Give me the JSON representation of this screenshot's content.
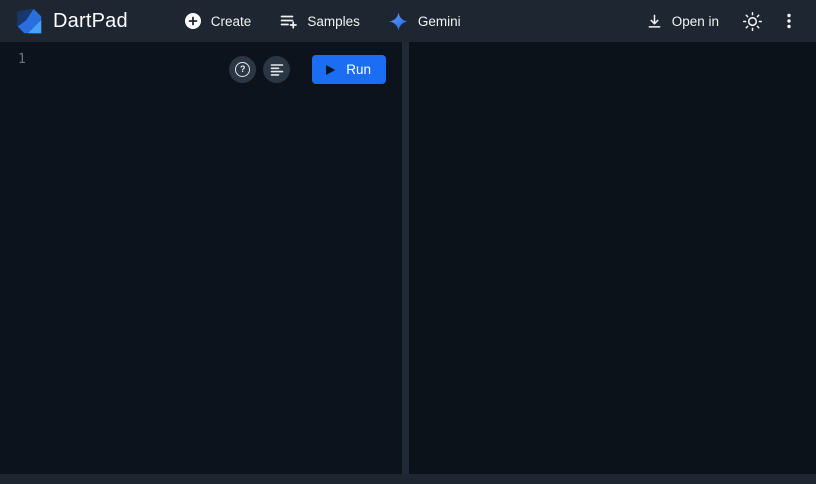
{
  "header": {
    "title": "DartPad",
    "nav": [
      {
        "label": "Create",
        "icon": "add-circle-icon"
      },
      {
        "label": "Samples",
        "icon": "playlist-add-icon"
      },
      {
        "label": "Gemini",
        "icon": "gemini-sparkle-icon"
      }
    ],
    "open_in": {
      "label": "Open in",
      "icon": "download-icon"
    },
    "theme_toggle_icon": "sun-icon",
    "overflow_menu_icon": "kebab-menu-icon"
  },
  "editor": {
    "line_numbers": [
      "1"
    ],
    "toolbar": {
      "help_glyph": "?",
      "help_icon": "help-icon",
      "format_icon": "format-align-left-icon",
      "run_label": "Run",
      "run_icon": "play-icon"
    },
    "content": ""
  },
  "output_panel": {
    "content": ""
  },
  "colors": {
    "header_bg": "#1d2631",
    "editor_bg": "#0d131c",
    "divider": "#202a37",
    "run_button_blue": "#1b6ef3",
    "gemini_blue": "#2f7bf2",
    "dart_logo_blue": "#2a6fdf"
  }
}
